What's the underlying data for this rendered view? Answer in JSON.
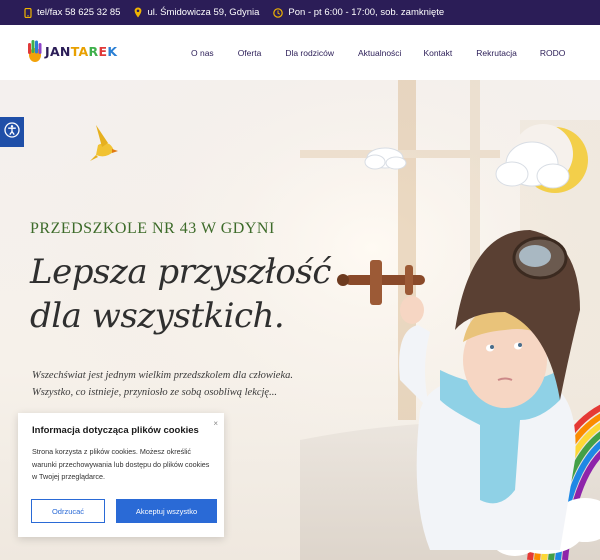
{
  "topbar": {
    "phone": "tel/fax 58 625 32 85",
    "address": "ul. Śmidowicza 59, Gdynia",
    "hours": "Pon - pt 6:00 - 17:00, sob. zamknięte"
  },
  "logo": {
    "text": "JANTAREK"
  },
  "menu": [
    {
      "label": "O nas"
    },
    {
      "label": "Oferta"
    },
    {
      "label": "Dla rodziców"
    },
    {
      "label": "Aktualności"
    },
    {
      "label": "Kontakt"
    },
    {
      "label": "Rekrutacja"
    },
    {
      "label": "RODO"
    }
  ],
  "hero": {
    "subtitle": "PRZEDSZKOLE NR 43 W GDYNI",
    "headline_line1": "Lepsza przyszłość",
    "headline_line2": "dla wszystkich.",
    "intro": "Wszechświat jest jednym wielkim przedszkolem dla człowieka. Wszystko, co istnieje, przyniosło ze sobą osobliwą lekcję..."
  },
  "cookie": {
    "title": "Informacja dotycząca plików cookies",
    "text": "Strona korzysta z plików cookies. Możesz określić warunki przechowywania lub dostępu do plików cookies w Twojej przeglądarce.",
    "decline_label": "Odrzucać",
    "accept_label": "Akceptuj wszystko",
    "close_symbol": "×"
  },
  "colors": {
    "topbar_bg": "#2b1d57",
    "accent_yellow": "#f0b400",
    "nav_text": "#2b1d57",
    "subtitle_green": "#3d6b2a",
    "button_blue": "#2a6ad6",
    "accessibility_blue": "#1f4fa8"
  },
  "icons": {
    "phone": "phone-icon",
    "address": "map-pin-icon",
    "hours": "clock-icon",
    "accessibility": "accessibility-icon"
  }
}
